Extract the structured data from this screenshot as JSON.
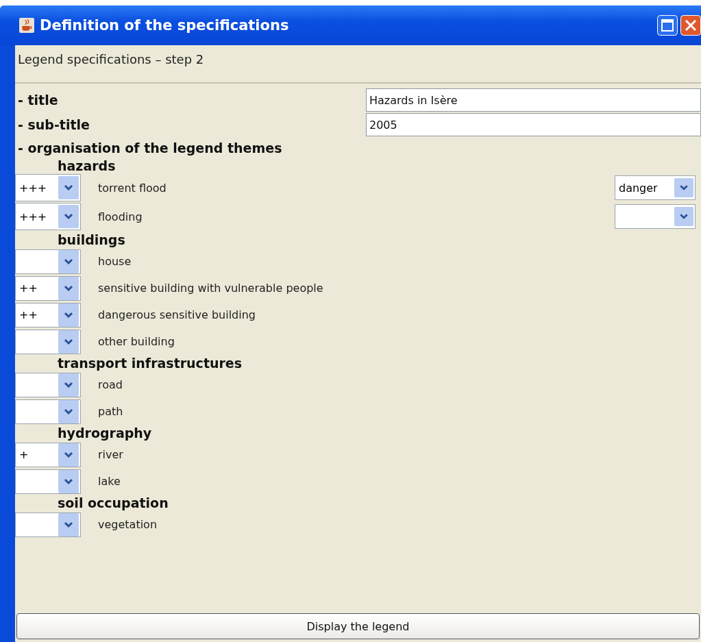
{
  "window": {
    "title": "Definition of the specifications"
  },
  "step_title": "Legend specifications – step 2",
  "fields": [
    {
      "label": "- title",
      "value": "Hazards in Isère"
    },
    {
      "label": "- sub-title",
      "value": "2005"
    }
  ],
  "section_label": "- organisation of the legend themes",
  "groups": [
    {
      "name": "hazards",
      "items": [
        {
          "kind": "hazard",
          "label": "torrent flood",
          "value": "+++",
          "category": "danger"
        },
        {
          "kind": "hazard",
          "label": "flooding",
          "value": "+++"
        }
      ]
    },
    {
      "name": "buildings",
      "items": [
        {
          "kind": "element",
          "label": "house"
        },
        {
          "kind": "element",
          "label": "sensitive building with vulnerable people",
          "value": "++"
        },
        {
          "kind": "element",
          "label": "dangerous sensitive building",
          "value": "++"
        },
        {
          "kind": "element",
          "label": "other building"
        }
      ]
    },
    {
      "name": "transport infrastructures",
      "items": [
        {
          "kind": "element",
          "label": "road"
        },
        {
          "kind": "element",
          "label": "path"
        }
      ]
    },
    {
      "name": "hydrography",
      "items": [
        {
          "kind": "element",
          "label": "river",
          "value": "+"
        },
        {
          "kind": "element",
          "label": "lake"
        }
      ]
    },
    {
      "name": "soil occupation",
      "items": [
        {
          "kind": "element",
          "label": "vegetation"
        }
      ]
    }
  ],
  "button": "Display the legend"
}
